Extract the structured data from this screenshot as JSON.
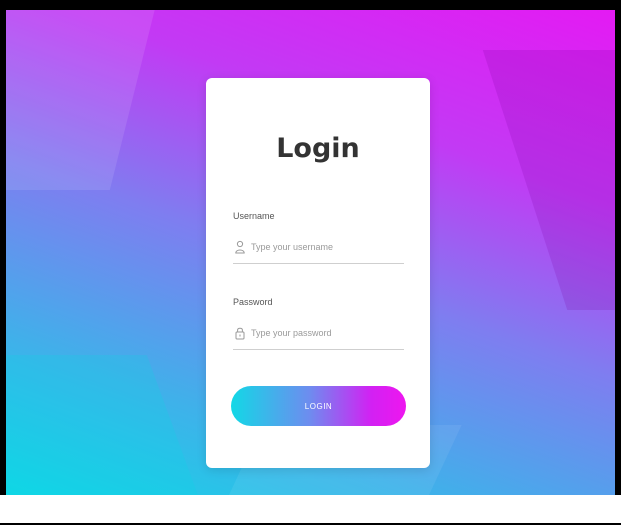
{
  "login_form": {
    "title": "Login",
    "username": {
      "label": "Username",
      "placeholder": "Type your username",
      "icon": "user-icon"
    },
    "password": {
      "label": "Password",
      "placeholder": "Type your password",
      "icon": "lock-icon"
    },
    "submit_label": "LOGIN"
  },
  "colors": {
    "gradient_start": "#12d6e6",
    "gradient_end": "#e41af3",
    "card_background": "#ffffff",
    "title_text": "#333333",
    "button_text": "#ffffff"
  }
}
